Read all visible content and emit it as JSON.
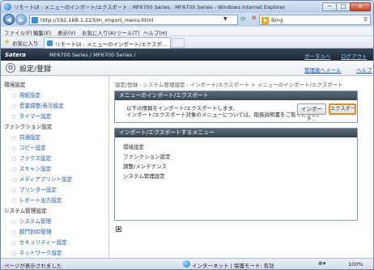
{
  "window": {
    "title": "リモートUI : メニューのインポート/エクスポート : MF6700 Series : MF6700 Series - Windows Internet Explorer",
    "minimize": "─",
    "maximize": "□",
    "close": "✕"
  },
  "address": {
    "url": "http://192.168.1.223/m_import_menu.html",
    "search_text": "Bing",
    "bing_logo": "b"
  },
  "menu": [
    "ファイル(F)",
    "編集(E)",
    "表示(V)",
    "お気に入り(A)",
    "ツール(T)",
    "ヘルプ(H)"
  ],
  "favorites": {
    "label": "お気に入り",
    "tab_title": "リモートUI : メニューのインポート/エクスポ..."
  },
  "header": {
    "brand": "Satera",
    "model": "MF6700 Series / MF6700 Series /",
    "portal_link": "ポータルへ",
    "logout_link": "ログアウト",
    "page_title": "設定/登録",
    "mail_link": "管理者へメール",
    "help_link": "ヘルプ"
  },
  "sidebar": {
    "cat1": "環境設定",
    "cat1_items": [
      "用紙設定",
      "音量調整/表示設定",
      "タイマー設定"
    ],
    "cat2": "ファンクション設定",
    "cat2_items": [
      "共通設定",
      "コピー設定",
      "ファクス設定",
      "スキャン設定",
      "メディアプリント設定",
      "プリンター設定",
      "レポート出力設定"
    ],
    "cat3": "システム管理設定",
    "cat3_items": [
      "システム管理",
      "部門別ID管理",
      "セキュリティー設定",
      "ネットワーク設定"
    ]
  },
  "content": {
    "breadcrumb": "設定/登録 : システム管理設定 : インポート/エクスポート > メニューのインポート/エクスポート",
    "box1_title": "メニューのインポート/エクスポート",
    "box1_line1": "以下の情報をインポート/エクスポートします。",
    "box1_line2": "インポート/エクスポート対象のメニューについては、取扱説明書をご覧ください。",
    "import_button": "インポート...",
    "export_button": "エクスポート開始",
    "box2_title": "インポート/エクスポートするメニュー",
    "box2_items": [
      "環境設定",
      "ファンクション設定",
      "調整/メンテナンス",
      "システム管理設定"
    ]
  },
  "status": {
    "text": "ページが表示されました",
    "zone": "インターネット | 保護モード: 有効",
    "zoom": "100%"
  }
}
